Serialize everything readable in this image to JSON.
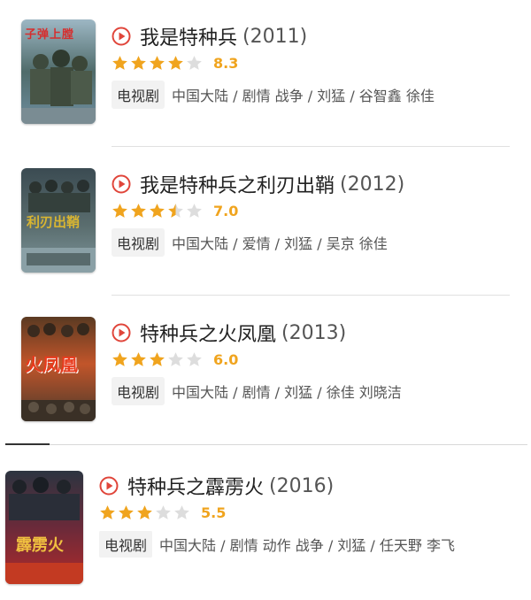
{
  "colors": {
    "star_filled": "#f0a41e",
    "star_empty": "#dddddd",
    "play_icon": "#e0453a",
    "divider": "#e0e0e0"
  },
  "items": [
    {
      "poster_text": "子弹上膛",
      "title": "我是特种兵",
      "year": "(2011)",
      "stars": 4,
      "score": "8.3",
      "tag": "电视剧",
      "meta": "中国大陆 / 剧情 战争 / 刘猛 / 谷智鑫 徐佳"
    },
    {
      "poster_text": "利刃出鞘",
      "title": "我是特种兵之利刃出鞘",
      "year": "(2012)",
      "stars": 3.5,
      "score": "7.0",
      "tag": "电视剧",
      "meta": "中国大陆 / 爱情 / 刘猛 / 吴京 徐佳"
    },
    {
      "poster_text": "火凤凰",
      "title": "特种兵之火凤凰",
      "year": "(2013)",
      "stars": 3,
      "score": "6.0",
      "tag": "电视剧",
      "meta": "中国大陆 / 剧情 / 刘猛 / 徐佳 刘晓洁"
    },
    {
      "poster_text": "霹雳火",
      "title": "特种兵之霹雳火",
      "year": "(2016)",
      "stars": 3,
      "score": "5.5",
      "tag": "电视剧",
      "meta": "中国大陆 / 剧情 动作 战争 / 刘猛 / 任天野 李飞"
    }
  ]
}
